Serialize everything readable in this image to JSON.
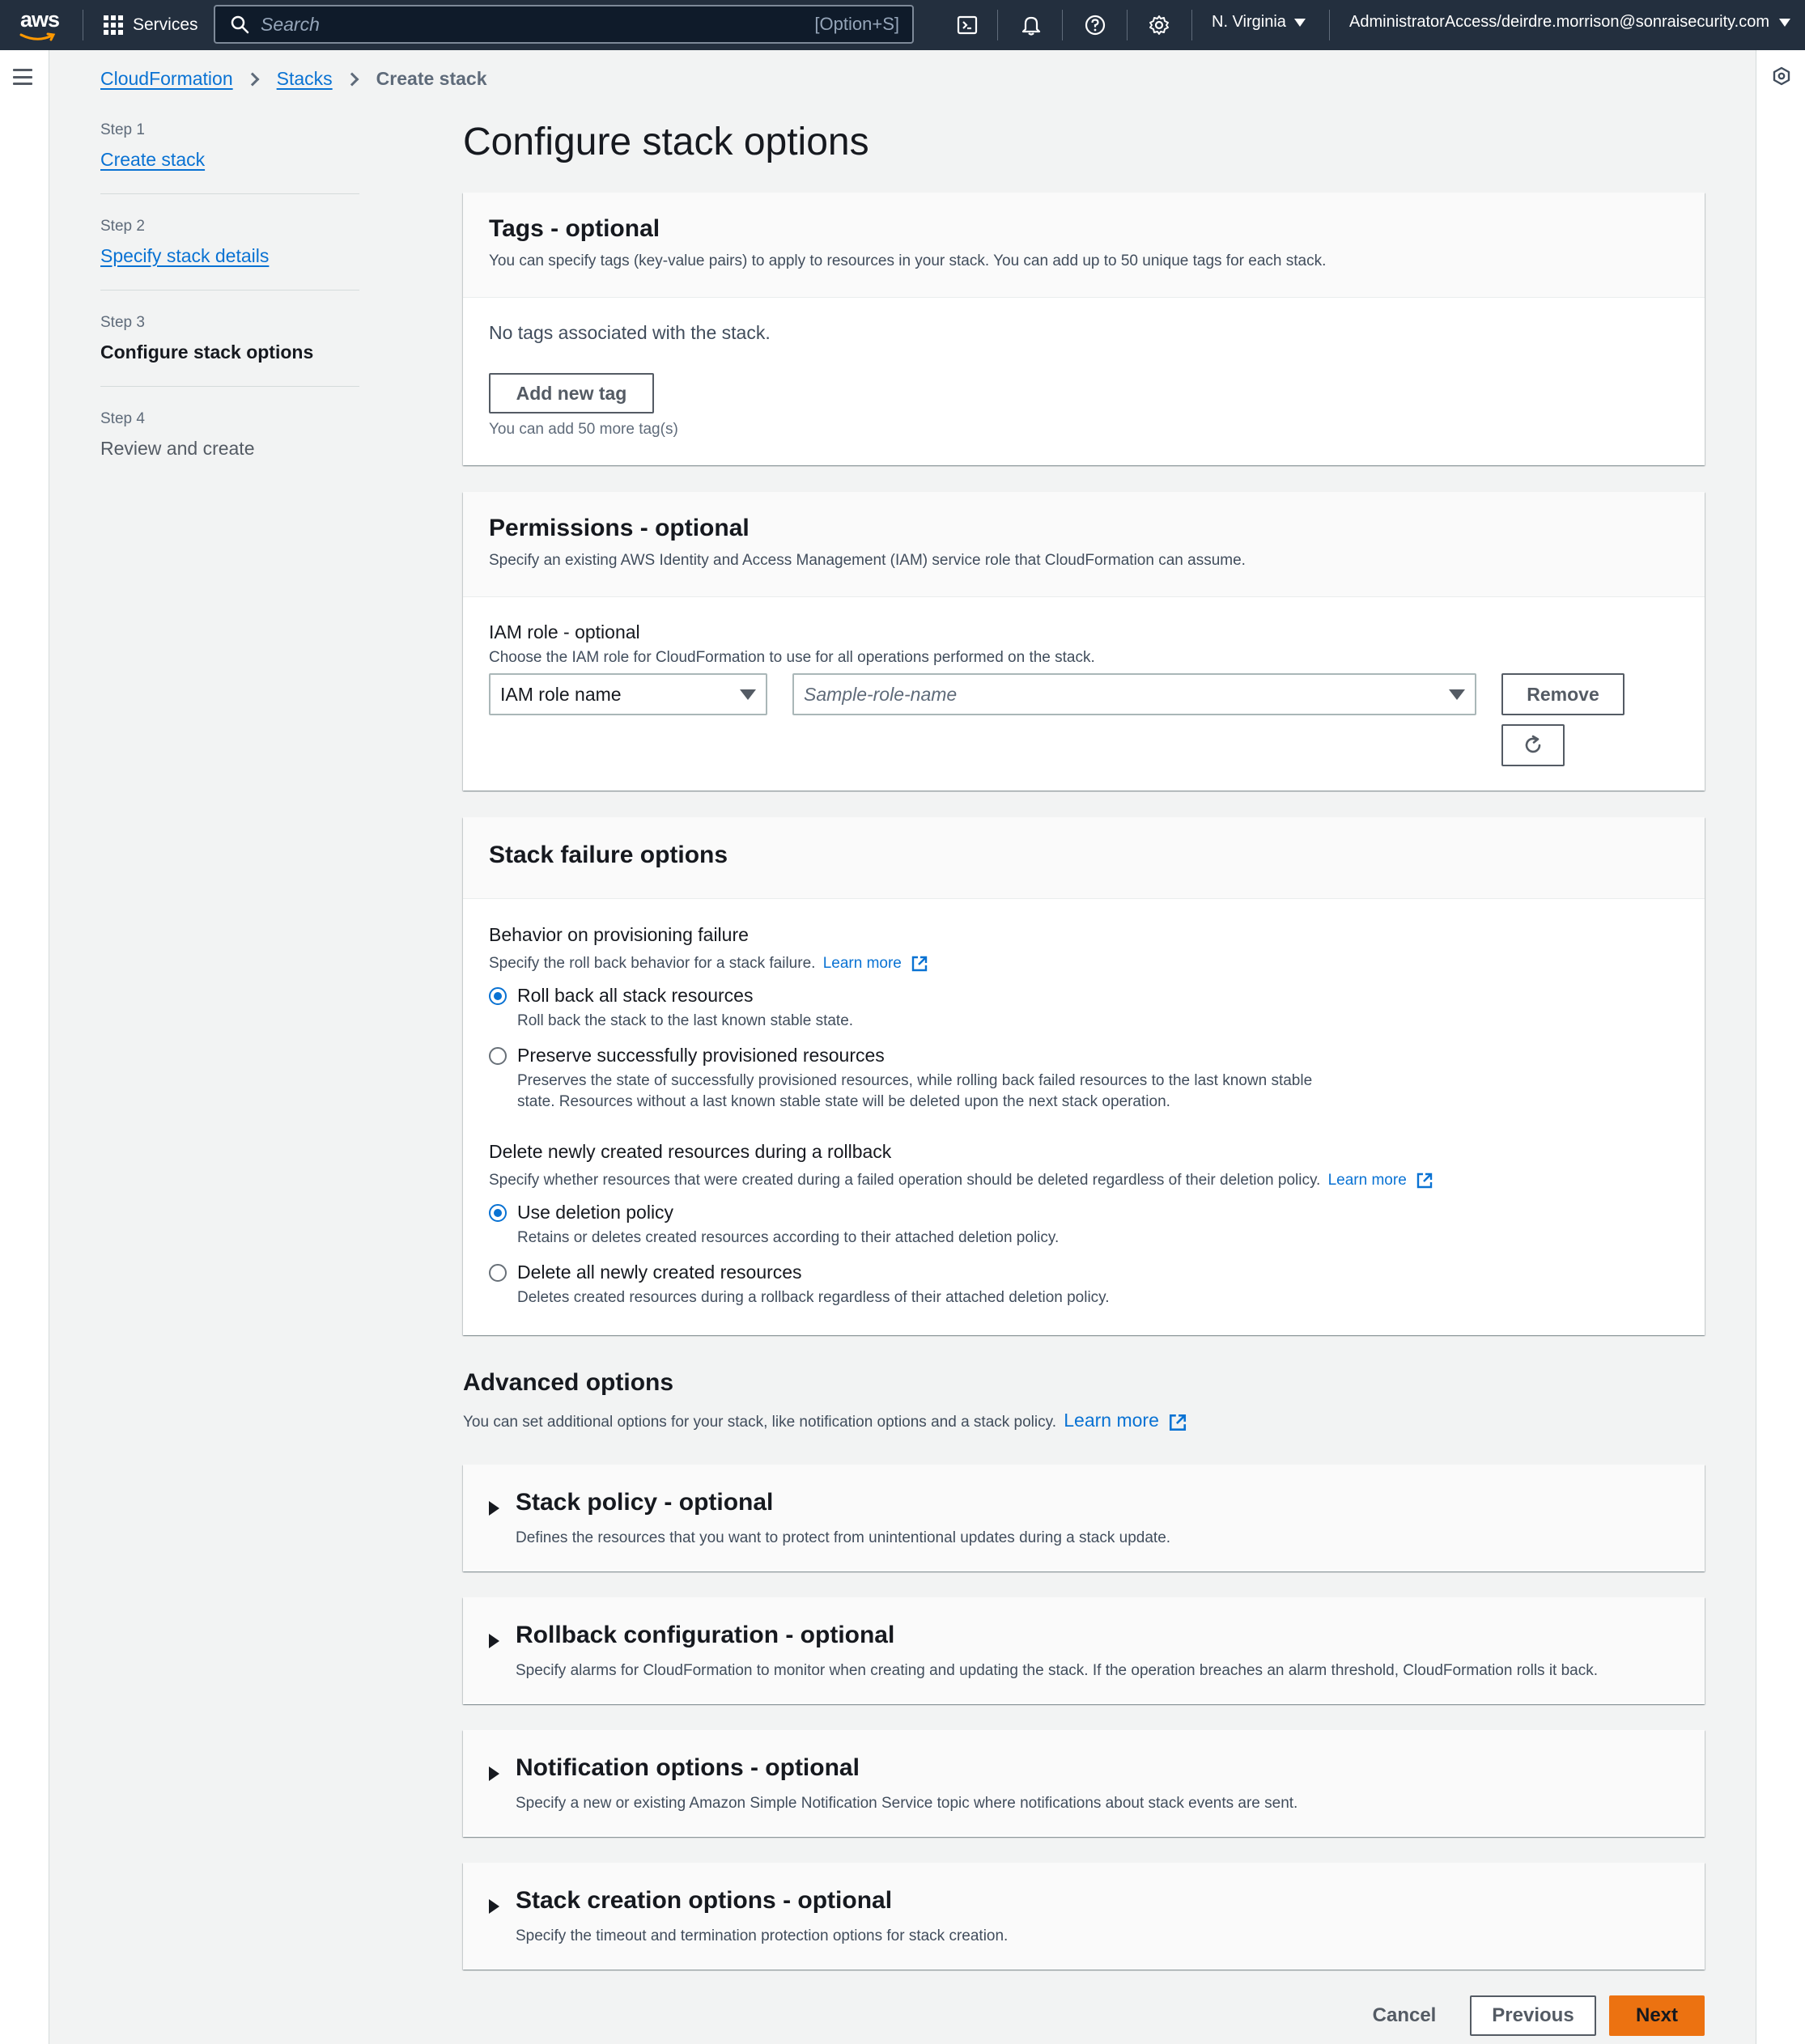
{
  "nav": {
    "logo": "aws",
    "services_label": "Services",
    "search_placeholder": "Search",
    "search_shortcut": "[Option+S]",
    "region": "N. Virginia",
    "account": "AdministratorAccess/deirdre.morrison@sonraisecurity.com",
    "icons": [
      "cloudshell-icon",
      "notifications-icon",
      "help-icon",
      "settings-icon"
    ]
  },
  "breadcrumb": {
    "items": [
      "CloudFormation",
      "Stacks"
    ],
    "current": "Create stack"
  },
  "steps": [
    {
      "label": "Step 1",
      "name": "Create stack",
      "state": "link"
    },
    {
      "label": "Step 2",
      "name": "Specify stack details",
      "state": "link"
    },
    {
      "label": "Step 3",
      "name": "Configure stack options",
      "state": "current"
    },
    {
      "label": "Step 4",
      "name": "Review and create",
      "state": "disabled"
    }
  ],
  "page_title": "Configure stack options",
  "tags": {
    "title": "Tags - optional",
    "description": "You can specify tags (key-value pairs) to apply to resources in your stack. You can add up to 50 unique tags for each stack.",
    "empty_text": "No tags associated with the stack.",
    "add_button": "Add new tag",
    "remaining": "You can add 50 more tag(s)"
  },
  "permissions": {
    "title": "Permissions - optional",
    "description": "Specify an existing AWS Identity and Access Management (IAM) service role that CloudFormation can assume.",
    "iam_label": "IAM role - optional",
    "iam_desc": "Choose the IAM role for CloudFormation to use for all operations performed on the stack.",
    "role_type": "IAM role name",
    "role_placeholder": "Sample-role-name",
    "remove_button": "Remove"
  },
  "failure": {
    "title": "Stack failure options",
    "behavior_label": "Behavior on provisioning failure",
    "behavior_desc": "Specify the roll back behavior for a stack failure.",
    "learn_more": "Learn more",
    "behavior_options": [
      {
        "title": "Roll back all stack resources",
        "desc": "Roll back the stack to the last known stable state.",
        "selected": true
      },
      {
        "title": "Preserve successfully provisioned resources",
        "desc1": "Preserves the state of successfully provisioned resources, while rolling back failed resources to the last known stable",
        "desc2": "state. Resources without a last known stable state will be deleted upon the next stack operation.",
        "selected": false
      }
    ],
    "delete_label": "Delete newly created resources during a rollback",
    "delete_desc": "Specify whether resources that were created during a failed operation should be deleted regardless of their deletion policy.",
    "delete_options": [
      {
        "title": "Use deletion policy",
        "desc": "Retains or deletes created resources according to their attached deletion policy.",
        "selected": true
      },
      {
        "title": "Delete all newly created resources",
        "desc": "Deletes created resources during a rollback regardless of their attached deletion policy.",
        "selected": false
      }
    ]
  },
  "advanced": {
    "title": "Advanced options",
    "description": "You can set additional options for your stack, like notification options and a stack policy.",
    "learn_more": "Learn more",
    "sections": [
      {
        "title": "Stack policy - optional",
        "desc": "Defines the resources that you want to protect from unintentional updates during a stack update."
      },
      {
        "title": "Rollback configuration - optional",
        "desc": "Specify alarms for CloudFormation to monitor when creating and updating the stack. If the operation breaches an alarm threshold, CloudFormation rolls it back."
      },
      {
        "title": "Notification options - optional",
        "desc": "Specify a new or existing Amazon Simple Notification Service topic where notifications about stack events are sent."
      },
      {
        "title": "Stack creation options - optional",
        "desc": "Specify the timeout and termination protection options for stack creation."
      }
    ]
  },
  "footer": {
    "cancel": "Cancel",
    "previous": "Previous",
    "next": "Next"
  },
  "colors": {
    "nav_bg": "#232f3e",
    "link": "#0972d3",
    "primary_button": "#ec7211"
  }
}
